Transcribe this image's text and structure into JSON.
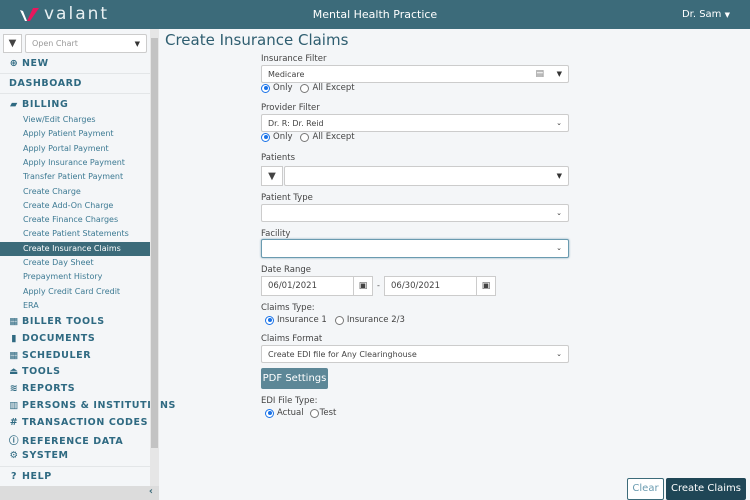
{
  "header": {
    "logo_text": "valant",
    "app_title": "Mental Health Practice",
    "user": "Dr. Sam",
    "colors": {
      "header": "#3c6b7a",
      "logo_accent": "#e8175d"
    }
  },
  "sidebar": {
    "open_chart_placeholder": "Open Chart",
    "new": "NEW",
    "dashboard": "DASHBOARD",
    "billing": "BILLING",
    "billing_items": [
      "View/Edit Charges",
      "Apply Patient Payment",
      "Apply Portal Payment",
      "Apply Insurance Payment",
      "Transfer Patient Payment",
      "Create Charge",
      "Create Add-On Charge",
      "Create Finance Charges",
      "Create Patient Statements",
      "Create Insurance Claims",
      "Create Day Sheet",
      "Prepayment History",
      "Apply Credit Card Credit",
      "ERA"
    ],
    "active_item": "Create Insurance Claims",
    "sections": [
      {
        "label": "BILLER TOOLS",
        "icon": "calculator-icon"
      },
      {
        "label": "DOCUMENTS",
        "icon": "file-icon"
      },
      {
        "label": "SCHEDULER",
        "icon": "calendar-icon"
      },
      {
        "label": "TOOLS",
        "icon": "toolbox-icon"
      },
      {
        "label": "REPORTS",
        "icon": "layers-icon"
      },
      {
        "label": "PERSONS & INSTITUTIONS",
        "icon": "building-icon"
      },
      {
        "label": "TRANSACTION CODES",
        "icon": "hash-icon"
      },
      {
        "label": "REFERENCE DATA",
        "icon": "info-icon"
      },
      {
        "label": "SYSTEM",
        "icon": "gears-icon"
      }
    ],
    "help": "HELP"
  },
  "main": {
    "title": "Create Insurance Claims",
    "insurance_filter": {
      "label": "Insurance Filter",
      "value": "Medicare",
      "only": "Only",
      "all_except": "All Except",
      "selected": "Only"
    },
    "provider_filter": {
      "label": "Provider Filter",
      "value": "Dr. R: Dr. Reid",
      "only": "Only",
      "all_except": "All Except",
      "selected": "Only"
    },
    "patients": {
      "label": "Patients",
      "value": ""
    },
    "patient_type": {
      "label": "Patient Type",
      "value": ""
    },
    "facility": {
      "label": "Facility",
      "value": ""
    },
    "date_range": {
      "label": "Date Range",
      "start": "06/01/2021",
      "separator": "-",
      "end": "06/30/2021"
    },
    "claims_type": {
      "label": "Claims Type:",
      "options": [
        "Insurance 1",
        "Insurance 2/3"
      ],
      "selected": "Insurance 1"
    },
    "claims_format": {
      "label": "Claims Format",
      "value": "Create EDI file for Any Clearinghouse"
    },
    "pdf_settings": "PDF Settings",
    "edi_file_type": {
      "label": "EDI File Type:",
      "options": [
        "Actual",
        "Test"
      ],
      "selected": "Actual"
    },
    "clear": "Clear",
    "create_claims": "Create Claims"
  }
}
